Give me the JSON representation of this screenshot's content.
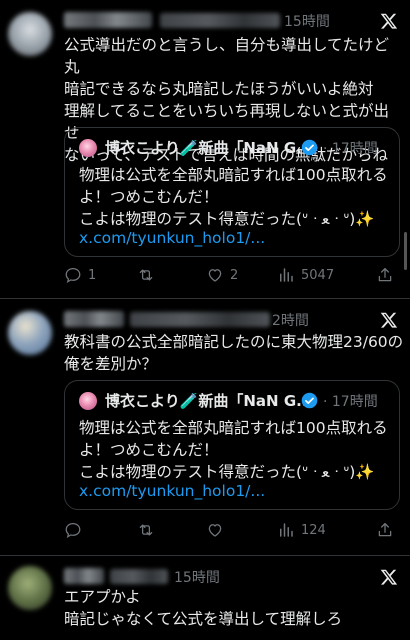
{
  "posts": [
    {
      "time": "15時間",
      "text": "公式導出だのと言うし、自分も導出してたけど丸\n暗記できるなら丸暗記したほうがいいよ絶対\n理解してることをいちいち再現しないと式が出せ\nないって、テストで言えば時間の無駄だからね",
      "quote": {
        "name": "博衣こより🧪新曲「NaN G...",
        "time": "· 17時間",
        "text": "物理は公式を全部丸暗記すれば100点取れる\nよ！つめこむんだ！\nこよは物理のテスト得意だった(ᐡ ᐧ ﻌ ᐧ ᐡ)✨",
        "link": "x.com/tyunkun_holo1/..."
      },
      "actions": {
        "reply": "1",
        "repost": "",
        "like": "2",
        "views": "5047"
      }
    },
    {
      "time": "2時間",
      "text": "教科書の公式全部暗記したのに東大物理23/60の\n俺を差別か？",
      "quote": {
        "name": "博衣こより🧪新曲「NaN G...",
        "time": "· 17時間",
        "text": "物理は公式を全部丸暗記すれば100点取れる\nよ！つめこむんだ！\nこよは物理のテスト得意だった(ᐡ ᐧ ﻌ ᐧ ᐡ)✨",
        "link": "x.com/tyunkun_holo1/..."
      },
      "actions": {
        "reply": "",
        "repost": "",
        "like": "",
        "views": "124"
      }
    },
    {
      "time": "15時間",
      "text": "エアプかよ\n暗記じゃなくて公式を導出して理解しろ"
    }
  ]
}
